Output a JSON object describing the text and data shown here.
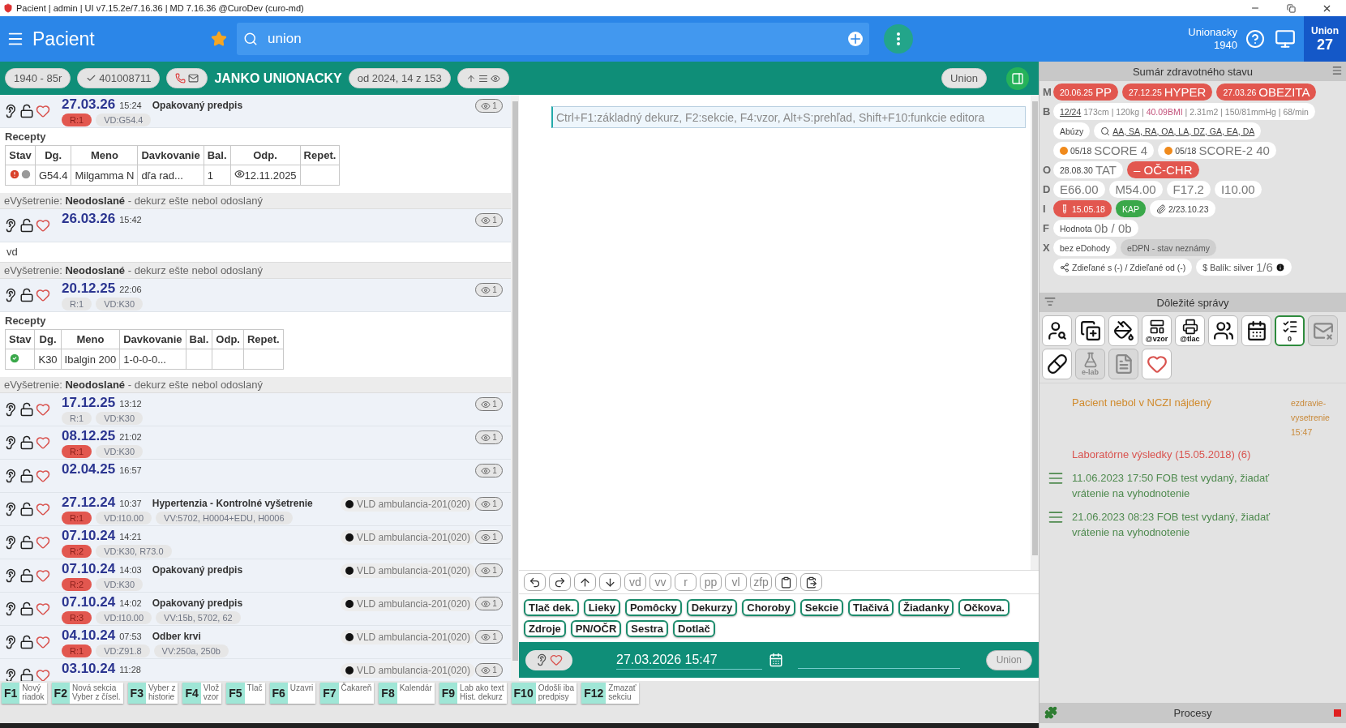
{
  "title_bar": {
    "title": "Pacient | admin | UI v7.15.2e/7.16.36 | MD 7.16.36 @CuroDev (curo-md)"
  },
  "app_bar": {
    "title": "Pacient",
    "favorite": true,
    "search": {
      "value": "union"
    },
    "user": {
      "name": "Unionacky",
      "year": "1940"
    },
    "badge": {
      "label": "Union",
      "count": "27"
    }
  },
  "patient_bar": {
    "birth": "1940 - 85r",
    "id": "401008711",
    "name": "JANKO UNIONACKY",
    "period": "od 2024, 14 z 153",
    "user": "Union"
  },
  "timeline": [
    {
      "kind": "visit",
      "date": "27.03.26",
      "time": "15:24",
      "title": "Opakovaný predpis",
      "badges": [
        {
          "text": "R:1",
          "alert": true
        },
        {
          "text": "VD:G54.4",
          "alert": false
        }
      ],
      "views": "1"
    },
    {
      "kind": "recipes",
      "title": "Recepty",
      "columns": [
        "Stav",
        "Dg.",
        "Meno",
        "Davkovanie",
        "Bal.",
        "Odp.",
        "Repet."
      ],
      "rows": [
        {
          "status_icons": [
            {
              "kind": "error"
            },
            {
              "kind": "pending"
            }
          ],
          "dg": "G54.4",
          "name": "Milgamma N",
          "dosage": "dľa rad...",
          "packs": "1",
          "pickup": "12.11.2025"
        }
      ]
    },
    {
      "kind": "status",
      "text": "eVyšetrenie: **Neodoslané** - dekurz ešte nebol odoslaný"
    },
    {
      "kind": "visit",
      "date": "26.03.26",
      "time": "15:42",
      "views": "1"
    },
    {
      "kind": "note",
      "text": "vd"
    },
    {
      "kind": "status",
      "text": "eVyšetrenie: **Neodoslané** - dekurz ešte nebol odoslaný"
    },
    {
      "kind": "visit",
      "date": "20.12.25",
      "time": "22:06",
      "badges": [
        {
          "text": "R:1",
          "alert": false
        },
        {
          "text": "VD:K30",
          "alert": false
        }
      ],
      "views": "1"
    },
    {
      "kind": "recipes",
      "title": "Recepty",
      "columns": [
        "Stav",
        "Dg.",
        "Meno",
        "Davkovanie",
        "Bal.",
        "Odp.",
        "Repet."
      ],
      "rows": [
        {
          "status_icons": [
            {
              "kind": "ok"
            }
          ],
          "dg": "K30",
          "name": "Ibalgin 200",
          "dosage": "1-0-0-0..."
        }
      ]
    },
    {
      "kind": "status",
      "text": "eVyšetrenie: **Neodoslané** - dekurz ešte nebol odoslaný"
    },
    {
      "kind": "visit",
      "date": "17.12.25",
      "time": "13:12",
      "badges": [
        {
          "text": "R:1",
          "alert": false
        },
        {
          "text": "VD:K30",
          "alert": false
        }
      ],
      "views": "1"
    },
    {
      "kind": "visit",
      "date": "08.12.25",
      "time": "21:02",
      "badges": [
        {
          "text": "R:1",
          "alert": true
        },
        {
          "text": "VD:K30",
          "alert": false
        }
      ],
      "views": "1"
    },
    {
      "kind": "visit",
      "date": "02.04.25",
      "time": "16:57",
      "views": "1"
    },
    {
      "kind": "visit",
      "date": "27.12.24",
      "time": "10:37",
      "title": "Hypertenzia - Kontrolné vyšetrenie",
      "place": "VLD ambulancia-201(020)",
      "badges": [
        {
          "text": "R:1",
          "alert": true
        },
        {
          "text": "VD:I10.00",
          "alert": false
        },
        {
          "text": "VV:5702, H0004+EDU, H0006",
          "alert": false
        }
      ],
      "views": "1"
    },
    {
      "kind": "visit",
      "date": "07.10.24",
      "time": "14:21",
      "place": "VLD ambulancia-201(020)",
      "badges": [
        {
          "text": "R:2",
          "alert": true
        },
        {
          "text": "VD:K30, R73.0",
          "alert": false
        }
      ],
      "views": "1"
    },
    {
      "kind": "visit",
      "date": "07.10.24",
      "time": "14:03",
      "title": "Opakovaný predpis",
      "place": "VLD ambulancia-201(020)",
      "badges": [
        {
          "text": "R:2",
          "alert": true
        },
        {
          "text": "VD:K30",
          "alert": false
        }
      ],
      "views": "1"
    },
    {
      "kind": "visit",
      "date": "07.10.24",
      "time": "14:02",
      "title": "Opakovaný predpis",
      "place": "VLD ambulancia-201(020)",
      "badges": [
        {
          "text": "R:3",
          "alert": true
        },
        {
          "text": "VD:I10.00",
          "alert": false
        },
        {
          "text": "VV:15b, 5702, 62",
          "alert": false
        }
      ],
      "views": "1"
    },
    {
      "kind": "visit",
      "date": "04.10.24",
      "time": "07:53",
      "title": "Odber krvi",
      "place": "VLD ambulancia-201(020)",
      "badges": [
        {
          "text": "R:1",
          "alert": true
        },
        {
          "text": "VD:Z91.8",
          "alert": false
        },
        {
          "text": "VV:250a, 250b",
          "alert": false
        }
      ],
      "views": "1"
    },
    {
      "kind": "visit",
      "date": "03.10.24",
      "time": "11:28",
      "place": "VLD ambulancia-201(020)",
      "views": "1"
    }
  ],
  "editor": {
    "placeholder": "Ctrl+F1:základný dekurz, F2:sekcie, F4:vzor, Alt+S:prehľad, Shift+F10:funkcie editora",
    "tools": [
      {
        "kind": "undo"
      },
      {
        "kind": "redo"
      },
      {
        "kind": "up"
      },
      {
        "kind": "down"
      },
      {
        "kind": "text",
        "label": "vd"
      },
      {
        "kind": "text",
        "label": "vv"
      },
      {
        "kind": "text",
        "label": "r"
      },
      {
        "kind": "text",
        "label": "pp"
      },
      {
        "kind": "text",
        "label": "vl"
      },
      {
        "kind": "text",
        "label": "zfp"
      },
      {
        "kind": "clipboard"
      },
      {
        "kind": "paste"
      }
    ],
    "sections": [
      "Tlač dek.",
      "Lieky",
      "Pomôcky",
      "Dekurzy",
      "Choroby",
      "Sekcie",
      "Tlačivá",
      "Žiadanky",
      "Očkova.",
      "Zdroje",
      "PN/OČR",
      "Sestra",
      "Dotlač"
    ],
    "date": "27.03.2026 15:47",
    "user": "Union"
  },
  "function_keys": [
    {
      "key": "F1",
      "lines": [
        "Nový",
        "riadok"
      ]
    },
    {
      "key": "F2",
      "lines": [
        "Nová sekcia",
        "Vyber z čísel."
      ]
    },
    {
      "key": "F3",
      "lines": [
        "Vyber z",
        "historie"
      ]
    },
    {
      "key": "F4",
      "lines": [
        "Vlož",
        "vzor"
      ]
    },
    {
      "key": "F5",
      "lines": [
        "Tlač"
      ]
    },
    {
      "key": "F6",
      "lines": [
        "Uzavri"
      ]
    },
    {
      "key": "F7",
      "lines": [
        "Čakareň"
      ]
    },
    {
      "key": "F8",
      "lines": [
        "Kalendár"
      ]
    },
    {
      "key": "F9",
      "lines": [
        "Lab ako text",
        "Hist. dekurz"
      ]
    },
    {
      "key": "F10",
      "lines": [
        "Odošli iba",
        "predpisy"
      ]
    },
    {
      "key": "F12",
      "lines": [
        "Zmazať",
        "sekciu"
      ]
    }
  ],
  "summary": {
    "title": "Sumár zdravotného stavu",
    "rows": [
      {
        "letter": "M",
        "chips": [
          {
            "kind": "diagnosis",
            "date": "20.06.25",
            "value": "PP"
          },
          {
            "kind": "diagnosis",
            "date": "27.12.25",
            "value": "HYPER"
          },
          {
            "kind": "diagnosis",
            "date": "27.03.26",
            "value": "OBEZITA"
          }
        ]
      },
      {
        "letter": "B",
        "chips": [
          {
            "kind": "measurements",
            "period": "12/24",
            "label": "173cm | 120kg |",
            "bmi": "40.09BMI",
            "rest": "| 2.31m2 | 150/81mmHg | 68/min"
          }
        ]
      },
      {
        "chips": [
          {
            "kind": "plain",
            "label": "Abúzy"
          },
          {
            "kind": "search",
            "link": "AA, SA, RA, OA, LA, DZ, GA, EA, DA"
          }
        ]
      },
      {
        "chips": [
          {
            "kind": "score",
            "color": "#f08a1c",
            "date": "05/18",
            "value": "SCORE 4"
          },
          {
            "kind": "score",
            "color": "#f08a1c",
            "date": "05/18",
            "value": "SCORE-2 40"
          }
        ]
      },
      {
        "letter": "O",
        "chips": [
          {
            "kind": "plain",
            "date": "28.08.30",
            "value": "TAT"
          },
          {
            "kind": "warning",
            "value": "– OČ-CHR"
          }
        ]
      },
      {
        "letter": "D",
        "chips": [
          {
            "kind": "plain",
            "value": "E66.00"
          },
          {
            "kind": "plain",
            "value": "M54.00"
          },
          {
            "kind": "plain",
            "value": "F17.2"
          },
          {
            "kind": "plain",
            "value": "I10.00"
          }
        ]
      },
      {
        "letter": "I",
        "chips": [
          {
            "kind": "lab",
            "label": "15.05.18"
          },
          {
            "kind": "flag",
            "label": "KAP"
          },
          {
            "kind": "attachment",
            "label": "2/23.10.23"
          }
        ]
      },
      {
        "letter": "F",
        "chips": [
          {
            "kind": "plain",
            "label": "Hodnota",
            "value": "0b / 0b"
          }
        ]
      },
      {
        "letter": "X",
        "chips": [
          {
            "kind": "plain",
            "label": "bez eDohody"
          },
          {
            "kind": "status",
            "label": "eDPN - stav neznámy"
          }
        ]
      },
      {
        "chips": [
          {
            "kind": "share",
            "label": "Zdieľané s (-) / Zdieľané od (-)"
          },
          {
            "kind": "package",
            "symbol": "$",
            "label": "Balík: silver",
            "value": "1/6"
          }
        ]
      }
    ]
  },
  "messages": {
    "title": "Dôležité správy",
    "tiles": [
      {
        "kind": "person-search",
        "active": false,
        "disabled": false
      },
      {
        "kind": "copy-add",
        "active": false,
        "disabled": false
      },
      {
        "kind": "fill",
        "active": false,
        "disabled": false
      },
      {
        "kind": "template",
        "label": "@vzor",
        "active": false,
        "disabled": false
      },
      {
        "kind": "print",
        "label": "@tlac",
        "active": false,
        "disabled": false
      },
      {
        "kind": "queue",
        "active": false,
        "disabled": false
      },
      {
        "kind": "calendar",
        "active": false,
        "disabled": false
      },
      {
        "kind": "checklist",
        "label": "0",
        "active": true,
        "disabled": false
      },
      {
        "kind": "mail-off",
        "active": false,
        "disabled": true
      },
      {
        "kind": "pills",
        "active": false,
        "disabled": false
      },
      {
        "kind": "flask",
        "label": "e-lab",
        "active": false,
        "disabled": true
      },
      {
        "kind": "document",
        "active": false,
        "disabled": true
      },
      {
        "kind": "eheart",
        "active": false,
        "disabled": false
      }
    ],
    "items": [
      {
        "kind": "warning",
        "text": "Pacient nebol v NCZI nájdený",
        "side": "ezdravie-vysetrenie 15:47"
      },
      {
        "kind": "alert",
        "text": "Laboratórne výsledky (15.05.2018) (6)"
      },
      {
        "kind": "task",
        "text": "11.06.2023 17:50 FOB test vydaný, žiadať vrátenie na vyhodnotenie"
      },
      {
        "kind": "task",
        "text": "21.06.2023 08:23 FOB test vydaný, žiadať vrátenie na vyhodnotenie"
      }
    ]
  },
  "processes": {
    "title": "Procesy"
  }
}
